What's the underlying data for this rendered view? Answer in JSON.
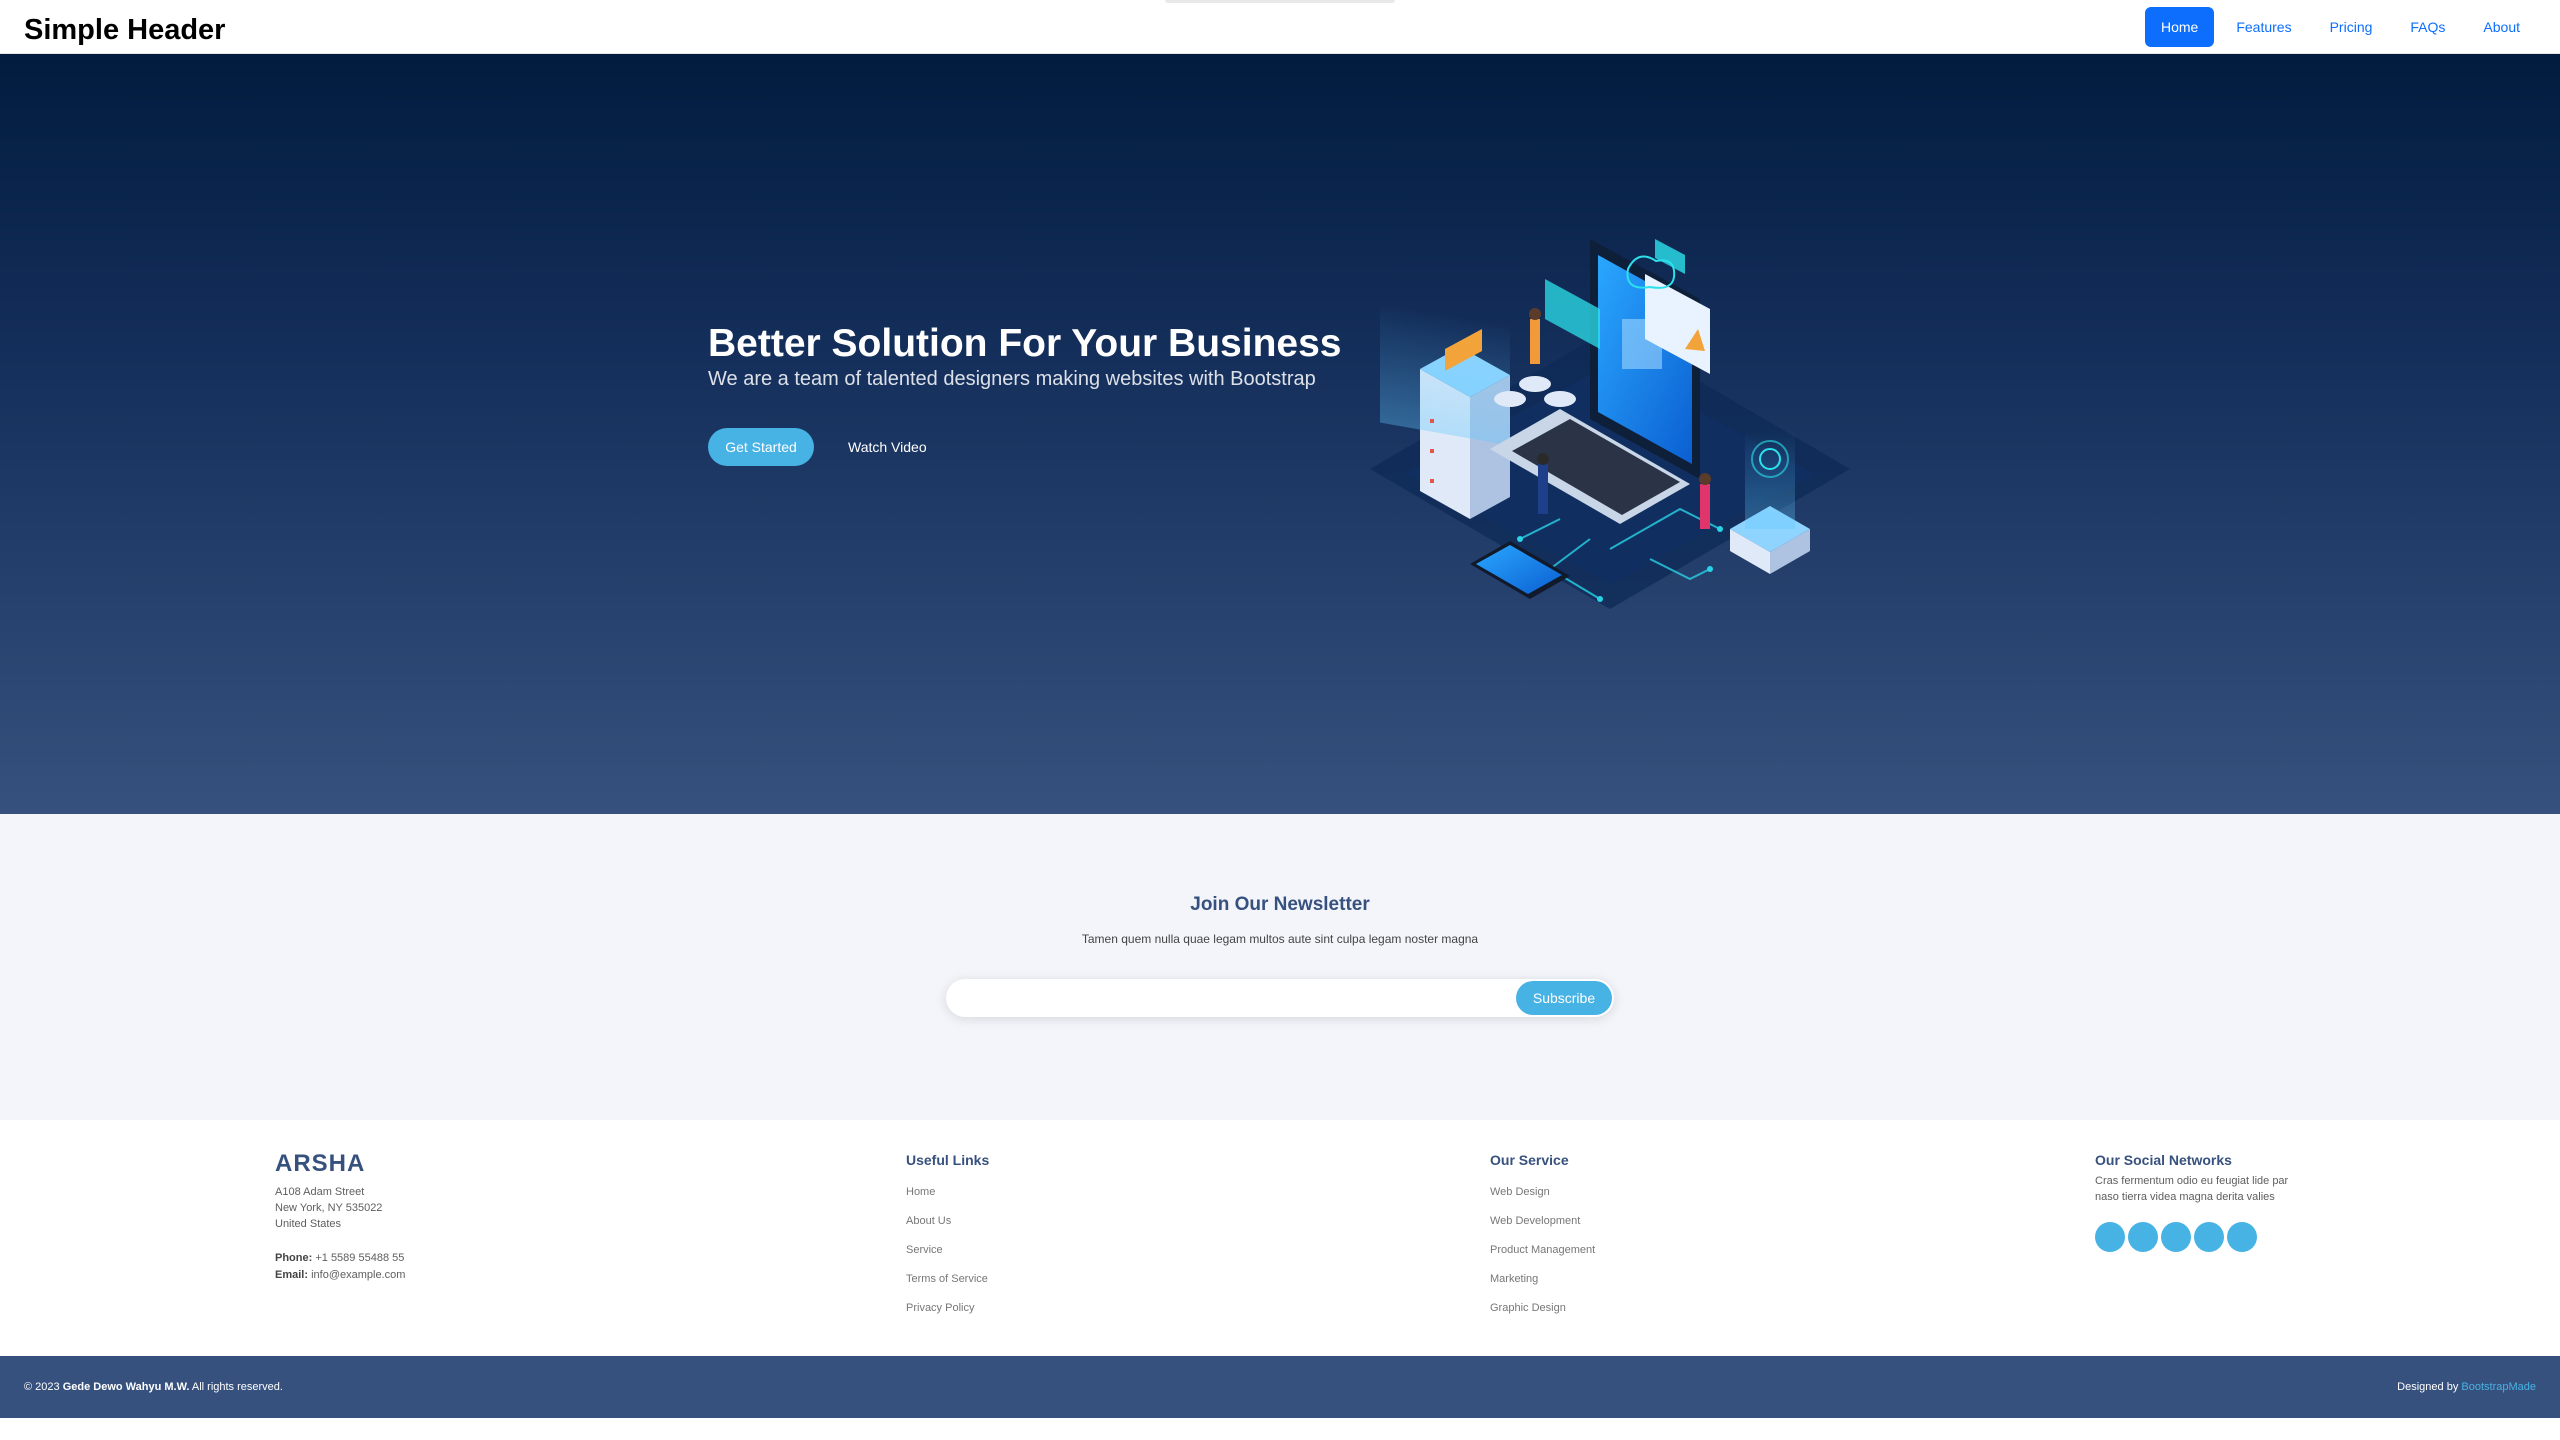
{
  "header": {
    "brand": "Simple Header",
    "nav": [
      "Home",
      "Features",
      "Pricing",
      "FAQs",
      "About"
    ],
    "active": "Home"
  },
  "hero": {
    "title": "Better Solution For Your Business",
    "subtitle": "We are a team of talented designers making websites with Bootstrap",
    "cta_primary": "Get Started",
    "cta_secondary": "Watch Video",
    "illustration": "isometric-laptop-servers-illustration"
  },
  "newsletter": {
    "title": "Join Our Newsletter",
    "text": "Tamen quem nulla quae legam multos aute sint culpa legam noster magna",
    "email_value": "",
    "button": "Subscribe"
  },
  "footer": {
    "logo": "ARSHA",
    "address": [
      "A108 Adam Street",
      "New York, NY 535022",
      "United States"
    ],
    "phone_label": "Phone:",
    "phone": "+1 5589 55488 55",
    "email_label": "Email:",
    "email": "info@example.com",
    "useful_links": {
      "title": "Useful Links",
      "items": [
        "Home",
        "About Us",
        "Service",
        "Terms of Service",
        "Privacy Policy"
      ]
    },
    "services": {
      "title": "Our Service",
      "items": [
        "Web Design",
        "Web Development",
        "Product Management",
        "Marketing",
        "Graphic Design"
      ]
    },
    "social": {
      "title": "Our Social Networks",
      "text": "Cras fermentum odio eu feugiat lide par naso tierra videa magna derita valies",
      "icons": [
        "twitter-icon",
        "facebook-icon",
        "instagram-icon",
        "skype-icon",
        "linkedin-icon"
      ]
    },
    "copyright_prefix": "© 2023",
    "copyright_name": "Gede Dewo Wahyu M.W.",
    "copyright_suffix": "All rights reserved.",
    "designed_by_label": "Designed by",
    "designed_by_link": "BootstrapMade"
  },
  "colors": {
    "accent": "#47b2e4",
    "primary_nav": "#0d6efd",
    "brand_dark": "#37517e",
    "hero_top": "#011c3e"
  }
}
